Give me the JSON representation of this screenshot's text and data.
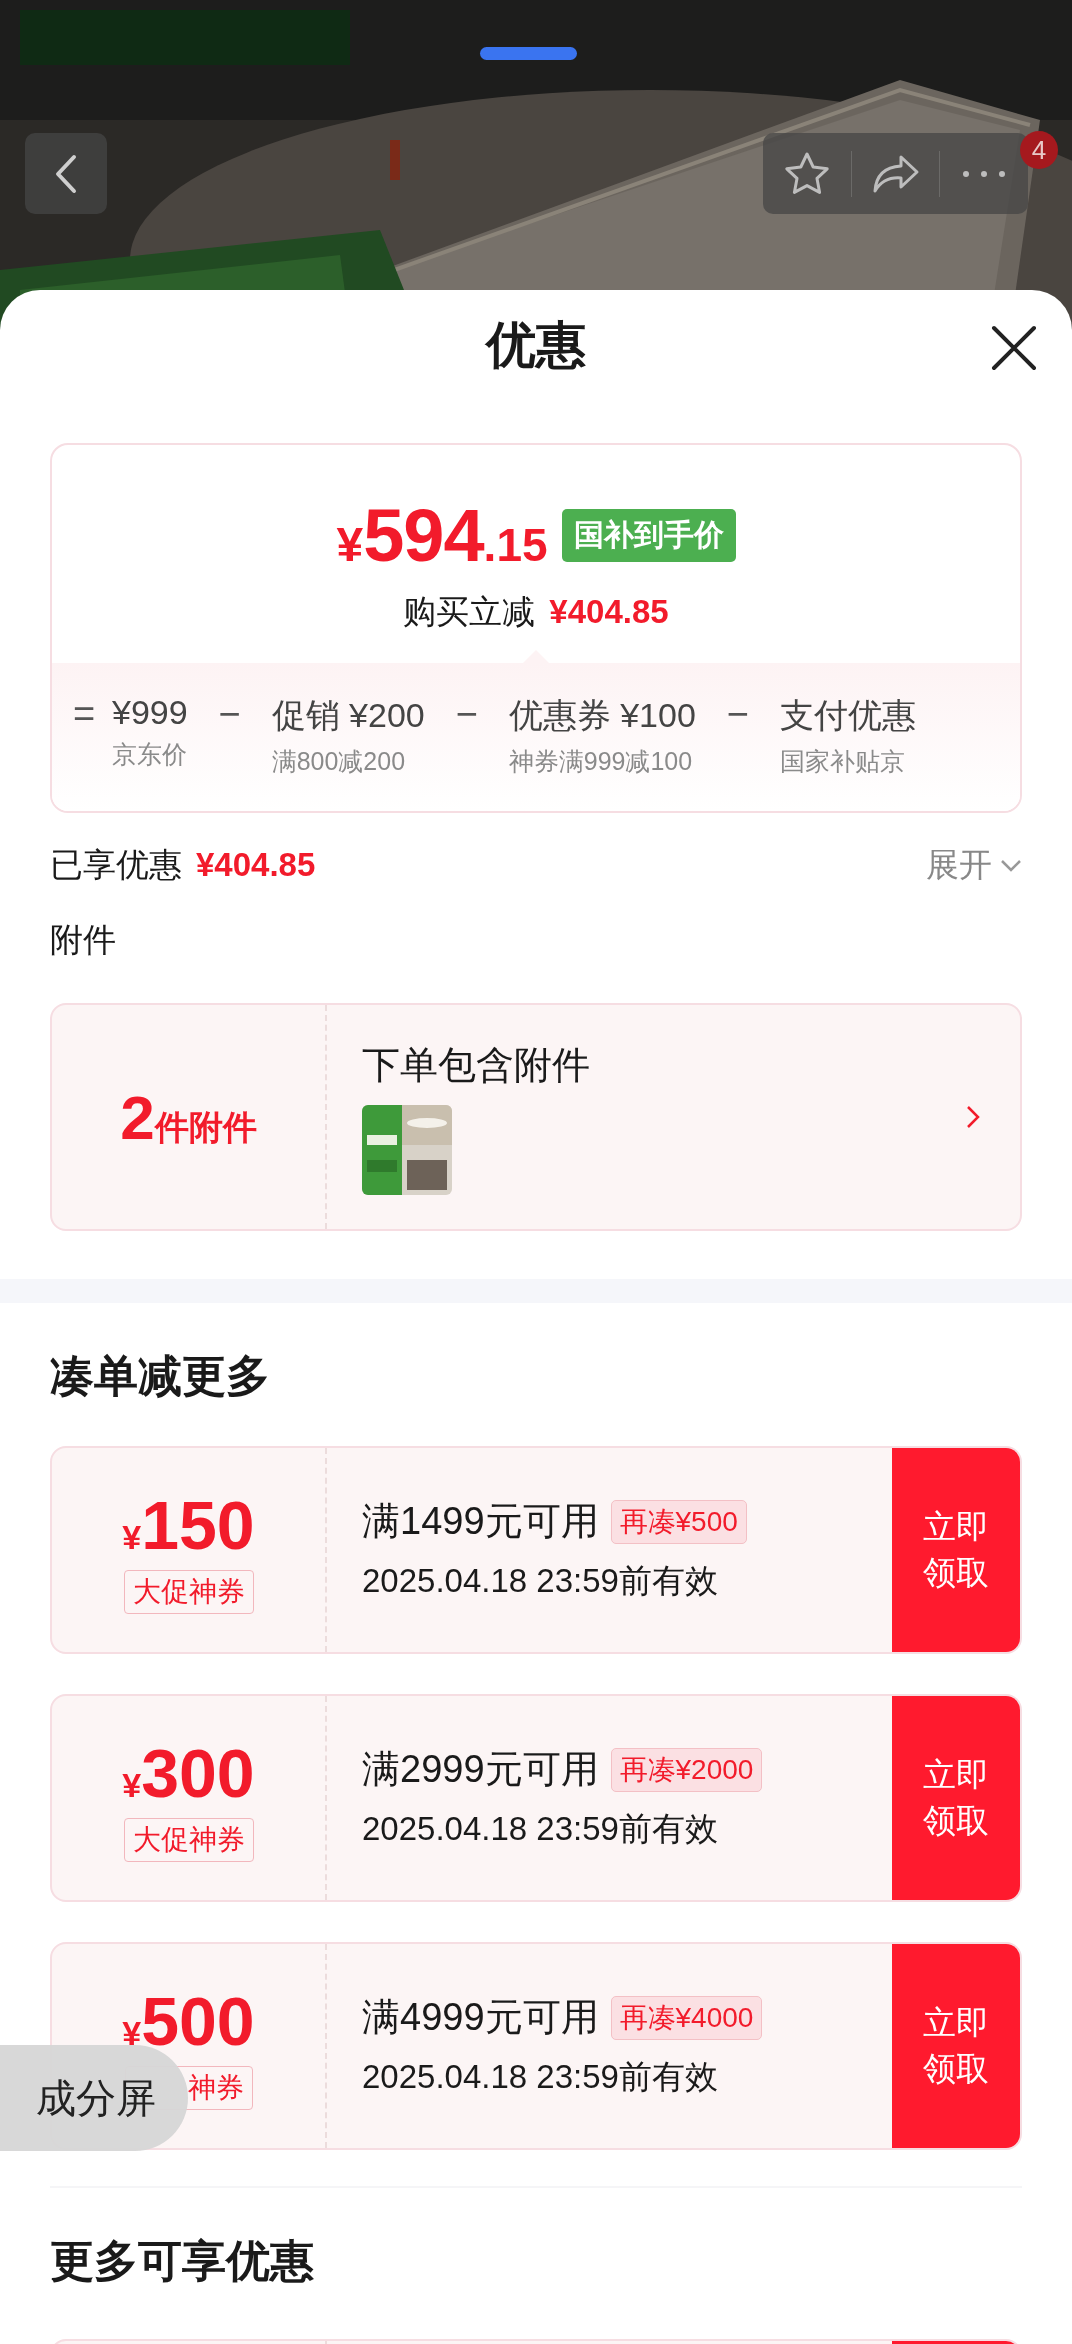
{
  "header": {
    "badge": "4"
  },
  "sheet": {
    "title": "优惠"
  },
  "price_card": {
    "currency": "¥",
    "integer": "594",
    "decimal": ".15",
    "badge": "国补到手价",
    "saving_label": "购买立减",
    "saving_amount": "¥404.85",
    "breakdown": [
      {
        "kind": "operator",
        "text": "="
      },
      {
        "kind": "term",
        "value": "¥999",
        "label": "京东价"
      },
      {
        "kind": "operator",
        "text": "−"
      },
      {
        "kind": "term",
        "value": "促销 ¥200",
        "label": "满800减200"
      },
      {
        "kind": "operator",
        "text": "−"
      },
      {
        "kind": "term",
        "value": "优惠券 ¥100",
        "label": "神券满999减100"
      },
      {
        "kind": "operator",
        "text": "−"
      },
      {
        "kind": "term",
        "value": "支付优惠",
        "label": "国家补贴京"
      }
    ]
  },
  "enjoyed": {
    "label": "已享优惠",
    "amount": "¥404.85",
    "toggle": "展开",
    "expanded": false
  },
  "attachments": {
    "heading": "附件",
    "count": "2",
    "count_unit": "件附件",
    "title": "下单包含附件"
  },
  "more_deals": {
    "heading": "凑单减更多",
    "coupons": [
      {
        "kind": "coupon",
        "currency": "¥",
        "amount": "150",
        "tag": "大促神券",
        "condition": "满1499元可用",
        "gap": "再凑¥500",
        "validity": "2025.04.18 23:59前有效",
        "button": "立即领取"
      },
      {
        "kind": "coupon",
        "currency": "¥",
        "amount": "300",
        "tag": "大促神券",
        "condition": "满2999元可用",
        "gap": "再凑¥2000",
        "validity": "2025.04.18 23:59前有效",
        "button": "立即领取"
      },
      {
        "kind": "coupon",
        "currency": "¥",
        "amount": "500",
        "tag": "神券",
        "condition": "满4999元可用",
        "gap": "再凑¥4000",
        "validity": "2025.04.18 23:59前有效",
        "button": "立即领取"
      }
    ]
  },
  "more_offers": {
    "heading": "更多可享优惠",
    "coupons": [
      {
        "kind": "peek"
      }
    ]
  },
  "split_screen_hint": {
    "text": "成分屏"
  }
}
